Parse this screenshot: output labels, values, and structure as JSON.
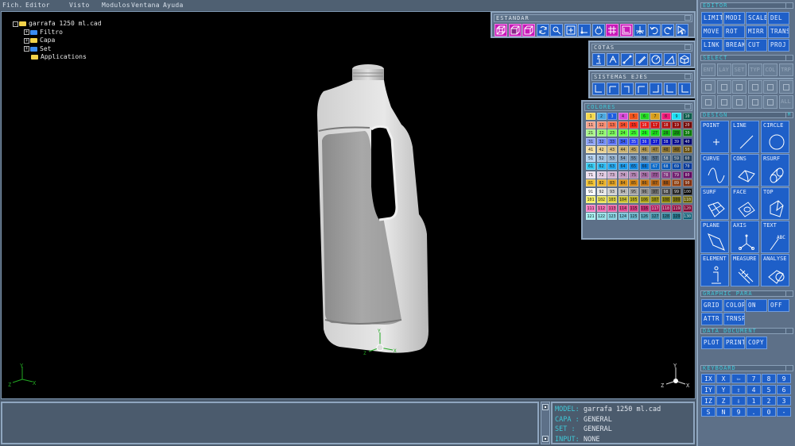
{
  "menu": [
    "Fich.",
    "Editor",
    "Visto",
    "Modulos",
    "Ventana",
    "Ayuda"
  ],
  "tree": {
    "root": "garrafa 1250 ml.cad",
    "children": [
      {
        "label": "Filtro",
        "color": "blue",
        "expandable": true
      },
      {
        "label": "Capa",
        "color": "yellow",
        "expandable": true
      },
      {
        "label": "Set",
        "color": "blue",
        "expandable": true
      },
      {
        "label": "Applications",
        "color": "yellow",
        "expandable": false
      }
    ]
  },
  "panels": {
    "estandar": {
      "title": "ESTANDAR",
      "icons": [
        "wireframe-cube-icon",
        "shaded-cube-icon",
        "hidden-line-cube-icon",
        "rotate-icon",
        "zoom-icon",
        "pan-icon",
        "axis-icon",
        "orbit-icon",
        "grid-icon",
        "frame-icon",
        "tripod-icon",
        "undo-icon",
        "redo-icon",
        "help-cursor-icon"
      ],
      "highlighted": [
        0,
        1,
        2,
        8,
        9
      ]
    },
    "cotas": {
      "title": "COTAS",
      "icons": [
        "info-icon",
        "angle-dimension-icon",
        "linear-dimension-icon",
        "aligned-dimension-icon",
        "radius-dimension-icon",
        "triangle-icon",
        "box-icon"
      ]
    },
    "sistemas_ejes": {
      "title": "SISTEMAS EJES",
      "icons": [
        "axes-yx-icon",
        "axes-xz-icon",
        "axes-zx-icon",
        "axes-xy-icon",
        "axes-zx2-icon",
        "axes-xz2-icon",
        "axes-plain-icon"
      ]
    },
    "colores": {
      "title": "COLORES",
      "swatches": [
        {
          "n": "1",
          "c": "#f5d84a"
        },
        {
          "n": "2",
          "c": "#4aa8e0"
        },
        {
          "n": "3",
          "c": "#1a5ce0"
        },
        {
          "n": "4",
          "c": "#d84ad8"
        },
        {
          "n": "5",
          "c": "#f0521a"
        },
        {
          "n": "6",
          "c": "#22d822"
        },
        {
          "n": "7",
          "c": "#d89e1a"
        },
        {
          "n": "8",
          "c": "#f01a7a"
        },
        {
          "n": "9",
          "c": "#1ae0f5"
        },
        {
          "n": "10",
          "c": "#0a5a4a"
        },
        {
          "n": "11",
          "c": "#f5a08a"
        },
        {
          "n": "12",
          "c": "#f58a70"
        },
        {
          "n": "13",
          "c": "#f56a4a"
        },
        {
          "n": "14",
          "c": "#f54a2a"
        },
        {
          "n": "15",
          "c": "#f52a1a"
        },
        {
          "n": "16",
          "c": "#e81a1a"
        },
        {
          "n": "17",
          "c": "#d01010"
        },
        {
          "n": "18",
          "c": "#b01010"
        },
        {
          "n": "19",
          "c": "#900a0a"
        },
        {
          "n": "20",
          "c": "#700808"
        },
        {
          "n": "21",
          "c": "#a8f58a"
        },
        {
          "n": "22",
          "c": "#90f570"
        },
        {
          "n": "23",
          "c": "#78f55a"
        },
        {
          "n": "24",
          "c": "#5af53a"
        },
        {
          "n": "25",
          "c": "#3af52a"
        },
        {
          "n": "26",
          "c": "#1af51a"
        },
        {
          "n": "27",
          "c": "#18d818"
        },
        {
          "n": "28",
          "c": "#12b812"
        },
        {
          "n": "29",
          "c": "#0e980e"
        },
        {
          "n": "30",
          "c": "#0a780a"
        },
        {
          "n": "31",
          "c": "#8aa0f5"
        },
        {
          "n": "32",
          "c": "#708af5"
        },
        {
          "n": "33",
          "c": "#5a70f5"
        },
        {
          "n": "34",
          "c": "#3a5af5"
        },
        {
          "n": "35",
          "c": "#2a40f5"
        },
        {
          "n": "36",
          "c": "#1a28e8"
        },
        {
          "n": "37",
          "c": "#1018d0"
        },
        {
          "n": "38",
          "c": "#0a10b0"
        },
        {
          "n": "39",
          "c": "#080c90"
        },
        {
          "n": "40",
          "c": "#060870"
        },
        {
          "n": "41",
          "c": "#f5e0a0"
        },
        {
          "n": "42",
          "c": "#e8d090"
        },
        {
          "n": "43",
          "c": "#d8c080"
        },
        {
          "n": "44",
          "c": "#c8b070"
        },
        {
          "n": "45",
          "c": "#b8a060"
        },
        {
          "n": "46",
          "c": "#a89050"
        },
        {
          "n": "47",
          "c": "#988040"
        },
        {
          "n": "48",
          "c": "#887030"
        },
        {
          "n": "49",
          "c": "#786020"
        },
        {
          "n": "50",
          "c": "#685010"
        },
        {
          "n": "51",
          "c": "#b0d0f0"
        },
        {
          "n": "52",
          "c": "#a0c0e0"
        },
        {
          "n": "53",
          "c": "#90b0d0"
        },
        {
          "n": "54",
          "c": "#80a0c0"
        },
        {
          "n": "55",
          "c": "#7090b0"
        },
        {
          "n": "56",
          "c": "#6080a0"
        },
        {
          "n": "57",
          "c": "#507090"
        },
        {
          "n": "58",
          "c": "#406080"
        },
        {
          "n": "59",
          "c": "#305070"
        },
        {
          "n": "60",
          "c": "#204060"
        },
        {
          "n": "61",
          "c": "#30c8f0"
        },
        {
          "n": "62",
          "c": "#28b8f0"
        },
        {
          "n": "63",
          "c": "#20a8f0"
        },
        {
          "n": "64",
          "c": "#1898e8"
        },
        {
          "n": "65",
          "c": "#1088e0"
        },
        {
          "n": "66",
          "c": "#0878d8"
        },
        {
          "n": "67",
          "c": "#0868c8"
        },
        {
          "n": "68",
          "c": "#0858b8"
        },
        {
          "n": "69",
          "c": "#0848a8"
        },
        {
          "n": "70",
          "c": "#083898"
        },
        {
          "n": "71",
          "c": "#f0e0f0"
        },
        {
          "n": "72",
          "c": "#e0c8e0"
        },
        {
          "n": "73",
          "c": "#d0b0d0"
        },
        {
          "n": "74",
          "c": "#c098c0"
        },
        {
          "n": "75",
          "c": "#b080b0"
        },
        {
          "n": "76",
          "c": "#a068a0"
        },
        {
          "n": "77",
          "c": "#905090"
        },
        {
          "n": "78",
          "c": "#803880"
        },
        {
          "n": "79",
          "c": "#702070"
        },
        {
          "n": "80",
          "c": "#600860"
        },
        {
          "n": "81",
          "c": "#f0c030"
        },
        {
          "n": "82",
          "c": "#e8b028"
        },
        {
          "n": "83",
          "c": "#e0a020"
        },
        {
          "n": "84",
          "c": "#d89018"
        },
        {
          "n": "85",
          "c": "#d08010"
        },
        {
          "n": "86",
          "c": "#c07010"
        },
        {
          "n": "87",
          "c": "#b06010"
        },
        {
          "n": "88",
          "c": "#a05010"
        },
        {
          "n": "89",
          "c": "#904010"
        },
        {
          "n": "90",
          "c": "#803010"
        },
        {
          "n": "91",
          "c": "#ffffff"
        },
        {
          "n": "92",
          "c": "#e8e8e8"
        },
        {
          "n": "93",
          "c": "#d0d0d0"
        },
        {
          "n": "94",
          "c": "#b8b8b8"
        },
        {
          "n": "95",
          "c": "#a0a0a0"
        },
        {
          "n": "96",
          "c": "#888888"
        },
        {
          "n": "97",
          "c": "#686868"
        },
        {
          "n": "98",
          "c": "#484848"
        },
        {
          "n": "99",
          "c": "#282828"
        },
        {
          "n": "100",
          "c": "#000000"
        },
        {
          "n": "101",
          "c": "#f5f060"
        },
        {
          "n": "102",
          "c": "#e8e050"
        },
        {
          "n": "103",
          "c": "#d8d040"
        },
        {
          "n": "104",
          "c": "#c8c030"
        },
        {
          "n": "105",
          "c": "#b8b020"
        },
        {
          "n": "106",
          "c": "#a8a018"
        },
        {
          "n": "107",
          "c": "#989010"
        },
        {
          "n": "108",
          "c": "#888008"
        },
        {
          "n": "109",
          "c": "#787008"
        },
        {
          "n": "110",
          "c": "#686008"
        },
        {
          "n": "111",
          "c": "#f878c0"
        },
        {
          "n": "112",
          "c": "#f068b0"
        },
        {
          "n": "113",
          "c": "#e858a0"
        },
        {
          "n": "114",
          "c": "#e04890"
        },
        {
          "n": "115",
          "c": "#d03880"
        },
        {
          "n": "116",
          "c": "#c02870"
        },
        {
          "n": "117",
          "c": "#b01860"
        },
        {
          "n": "118",
          "c": "#a01050"
        },
        {
          "n": "119",
          "c": "#900840"
        },
        {
          "n": "120",
          "c": "#800030"
        },
        {
          "n": "121",
          "c": "#a0f0f0"
        },
        {
          "n": "122",
          "c": "#90e0e8"
        },
        {
          "n": "123",
          "c": "#80d0e0"
        },
        {
          "n": "124",
          "c": "#70c0d8"
        },
        {
          "n": "125",
          "c": "#60b0c8"
        },
        {
          "n": "126",
          "c": "#50a0b8"
        },
        {
          "n": "127",
          "c": "#4090a8"
        },
        {
          "n": "128",
          "c": "#308098"
        },
        {
          "n": "129",
          "c": "#207088"
        },
        {
          "n": "130",
          "c": "#106078"
        }
      ]
    }
  },
  "right_panel": {
    "editor": {
      "title": "EDITOR",
      "buttons": [
        "LIMIT",
        "MODI",
        "SCALE",
        "DEL",
        "MOVE",
        "ROT",
        "MIRR",
        "TRANS",
        "LINK",
        "BREAK",
        "CUT",
        "PROJ"
      ]
    },
    "select": {
      "title": "SELECT",
      "filters": [
        "ENT",
        "LAY",
        "SET",
        "TYP",
        "COL",
        "TRP"
      ],
      "icons": [
        "point-select-icon",
        "curve-select-icon",
        "surface-select-icon",
        "face-select-icon",
        "solid-select-icon",
        "shell-select-icon",
        "plane-select-icon",
        "axis-select-icon",
        "box-select-icon",
        "group-select-icon",
        "multi-select-icon"
      ],
      "all_label": "ALL"
    },
    "design": {
      "title": "DESIGN",
      "mode": "M",
      "tools": [
        {
          "label": "POINT",
          "icon": "point-icon"
        },
        {
          "label": "LINE",
          "icon": "line-icon"
        },
        {
          "label": "CIRCLE",
          "icon": "circle-icon"
        },
        {
          "label": "CURVE",
          "icon": "curve-icon"
        },
        {
          "label": "CONS",
          "icon": "cons-surface-icon"
        },
        {
          "label": "RSURF",
          "icon": "rsurf-icon"
        },
        {
          "label": "SURF",
          "icon": "surf-icon"
        },
        {
          "label": "FACE",
          "icon": "face-icon"
        },
        {
          "label": "TOP",
          "icon": "top-icon"
        },
        {
          "label": "PLANE",
          "icon": "plane-icon"
        },
        {
          "label": "AXIS",
          "icon": "axis-icon"
        },
        {
          "label": "TEXT",
          "icon": "text-icon"
        },
        {
          "label": "ELEMENT",
          "icon": "element-info-icon"
        },
        {
          "label": "MEASURE",
          "icon": "caliper-icon"
        },
        {
          "label": "ANALYSE",
          "icon": "analyse-icon"
        }
      ],
      "text_icon_label": "ABC"
    },
    "graphic_para": {
      "title": "GRAPHIC  PARA",
      "buttons": [
        "GRID",
        "COLOR",
        "ON",
        "OFF",
        "ATTR",
        "TRNSP"
      ]
    },
    "data_document": {
      "title": "DATA    DOCUMENT",
      "buttons": [
        "PLOT",
        "PRINT",
        "COPY"
      ]
    },
    "keyboard": {
      "title": "KEYBOARD",
      "keys": [
        "IX",
        "X",
        "⇦",
        "7",
        "8",
        "9",
        "IY",
        "Y",
        "⇧",
        "4",
        "5",
        "6",
        "IZ",
        "Z",
        "⇩",
        "1",
        "2",
        "3",
        "S",
        "N",
        "9",
        ".",
        "0",
        "-"
      ]
    }
  },
  "status": {
    "rows": [
      {
        "key": "MODEL:",
        "value": "garrafa 1250 ml.cad"
      },
      {
        "key": "CAPA :",
        "value": "GENERAL"
      },
      {
        "key": "SET  :",
        "value": "GENERAL"
      },
      {
        "key": "INPUT:",
        "value": "NONE"
      }
    ]
  },
  "axes": {
    "x": "X",
    "y": "Y",
    "z": "Z"
  },
  "colors": {
    "viewport_bg": "#000000",
    "panel_bg": "#5d7088",
    "button_blue": "#1e5fc8",
    "highlight_magenta": "#c81ab8",
    "title_cyan": "#3fc8d8",
    "triad_green": "#22a822"
  }
}
